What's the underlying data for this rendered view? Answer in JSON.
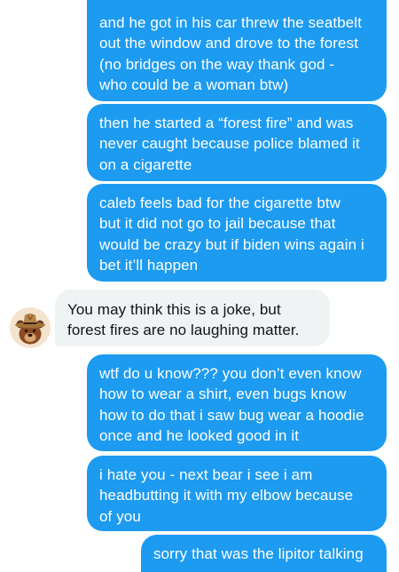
{
  "conversation": {
    "messages": [
      {
        "id": "m1",
        "direction": "outgoing",
        "text": "and he got in his car threw the seatbelt\nout the window and drove to the forest\n(no bridges on the way thank god -\nwho could be a woman btw)"
      },
      {
        "id": "m2",
        "direction": "outgoing",
        "text": "then he started a “forest fire” and was\nnever caught because police blamed it\non a cigarette"
      },
      {
        "id": "m3",
        "direction": "outgoing",
        "text": "caleb feels bad for the cigarette btw\nbut it did not go to jail because that\nwould be crazy but if biden wins again i\nbet it’ll happen"
      },
      {
        "id": "m4",
        "direction": "incoming",
        "text": "You may think this is a joke, but\nforest fires are no laughing matter."
      },
      {
        "id": "m5",
        "direction": "outgoing",
        "text": "wtf do u know??? you don’t even know\nhow to wear a shirt, even bugs know\nhow to do that i saw bug wear a hoodie\nonce and he looked good in it"
      },
      {
        "id": "m6",
        "direction": "outgoing",
        "text": "i hate you - next bear i see i am\nheadbutting it with my elbow because\nof you"
      },
      {
        "id": "m7",
        "direction": "outgoing",
        "text": "sorry that was the lipitor talking"
      }
    ],
    "avatar_icon": "smokey-bear-ranger-hat-avatar",
    "colors": {
      "outgoing_bubble": "#1d9bf0",
      "incoming_bubble": "#eff3f4",
      "outgoing_text": "#ffffff",
      "incoming_text": "#0f1419"
    }
  }
}
